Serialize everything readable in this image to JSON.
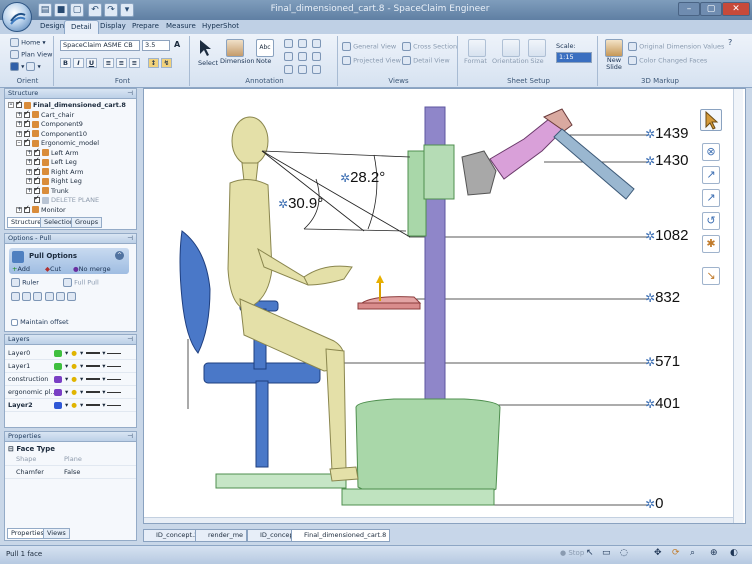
{
  "window": {
    "title": "Final_dimensioned_cart.8 - SpaceClaim Engineer"
  },
  "ribbon_tabs": [
    "Design",
    "Detail",
    "Display",
    "Prepare",
    "Measure",
    "HyperShot"
  ],
  "ribbon": {
    "orient": {
      "label": "Orient",
      "home": "Home",
      "plan_view": "Plan View"
    },
    "font": {
      "label": "Font",
      "face": "SpaceClaim ASME CB",
      "size": "3.5"
    },
    "annotation": {
      "label": "Annotation",
      "select": "Select",
      "dimension": "Dimension",
      "note": "Note"
    },
    "views": {
      "label": "Views",
      "general_view": "General View",
      "cross_section": "Cross Section",
      "projected_view": "Projected View",
      "detail_view": "Detail View"
    },
    "sheet_setup": {
      "label": "Sheet Setup",
      "format": "Format",
      "orientation": "Orientation",
      "size": "Size",
      "scale_label": "Scale:",
      "scale_value": "1:15"
    },
    "markup": {
      "label": "3D Markup",
      "new_slide": "New Slide",
      "original_dim": "Original Dimension Values",
      "color_changed": "Color Changed Faces"
    }
  },
  "structure": {
    "title": "Structure",
    "items": [
      {
        "label": "Final_dimensioned_cart.8",
        "depth": 0
      },
      {
        "label": "Cart_chair",
        "depth": 1
      },
      {
        "label": "Component9",
        "depth": 1
      },
      {
        "label": "Component10",
        "depth": 1
      },
      {
        "label": "Ergonomic_model",
        "depth": 1
      },
      {
        "label": "Left Arm",
        "depth": 2
      },
      {
        "label": "Left Leg",
        "depth": 2
      },
      {
        "label": "Right Arm",
        "depth": 2
      },
      {
        "label": "Right Leg",
        "depth": 2
      },
      {
        "label": "Trunk",
        "depth": 2
      },
      {
        "label": "DELETE PLANE",
        "depth": 2
      },
      {
        "label": "Monitor",
        "depth": 1
      }
    ],
    "tabs": [
      "Structure",
      "Selection",
      "Groups"
    ]
  },
  "options": {
    "title": "Options - Pull",
    "section": "Pull Options",
    "add": "Add",
    "cut": "Cut",
    "no_merge": "No merge",
    "ruler": "Ruler",
    "full_pull": "Full Pull",
    "maintain_offset": "Maintain offset"
  },
  "layers": {
    "title": "Layers",
    "items": [
      {
        "name": "Layer0",
        "color": "#3fbf3f"
      },
      {
        "name": "Layer1",
        "color": "#3fbf3f"
      },
      {
        "name": "construction",
        "color": "#7a3fc4"
      },
      {
        "name": "ergonomic pl...",
        "color": "#7a3fc4"
      },
      {
        "name": "Layer2",
        "color": "#2f58d6"
      }
    ]
  },
  "properties": {
    "title": "Properties",
    "section": "Face Type",
    "rows": [
      {
        "key": "Shape",
        "value": "Plane"
      },
      {
        "key": "Chamfer",
        "value": "False"
      }
    ],
    "tabs": [
      "Properties",
      "Views"
    ]
  },
  "dimensions": {
    "heights": [
      "1439",
      "1430",
      "1082",
      "832",
      "571",
      "401",
      "0"
    ],
    "angles": [
      "28.2°",
      "30.9°"
    ]
  },
  "doc_tabs": [
    "ID_concept.2",
    "render_me",
    "ID_concept",
    "Final_dimensioned_cart.8"
  ],
  "status": {
    "text": "Pull 1 face",
    "stop": "Stop"
  }
}
